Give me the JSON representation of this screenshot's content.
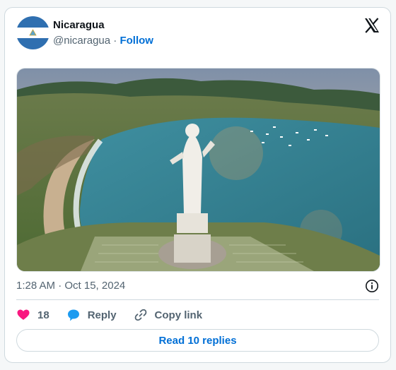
{
  "author": {
    "name": "Nicaragua",
    "handle": "@nicaragua",
    "separator": " · ",
    "follow_label": "Follow"
  },
  "post": {
    "image_icon": "statue-bay-photo",
    "timestamp": "1:28 AM · Oct 15, 2024"
  },
  "actions": {
    "likes_count": "18",
    "reply_label": "Reply",
    "copy_link_label": "Copy link"
  },
  "read_replies_label": "Read 10 replies",
  "colors": {
    "flag_blue": "#2f6fb0",
    "like_pink": "#f91880",
    "reply_blue": "#1d9bf0",
    "link_blue": "#006fd6"
  }
}
